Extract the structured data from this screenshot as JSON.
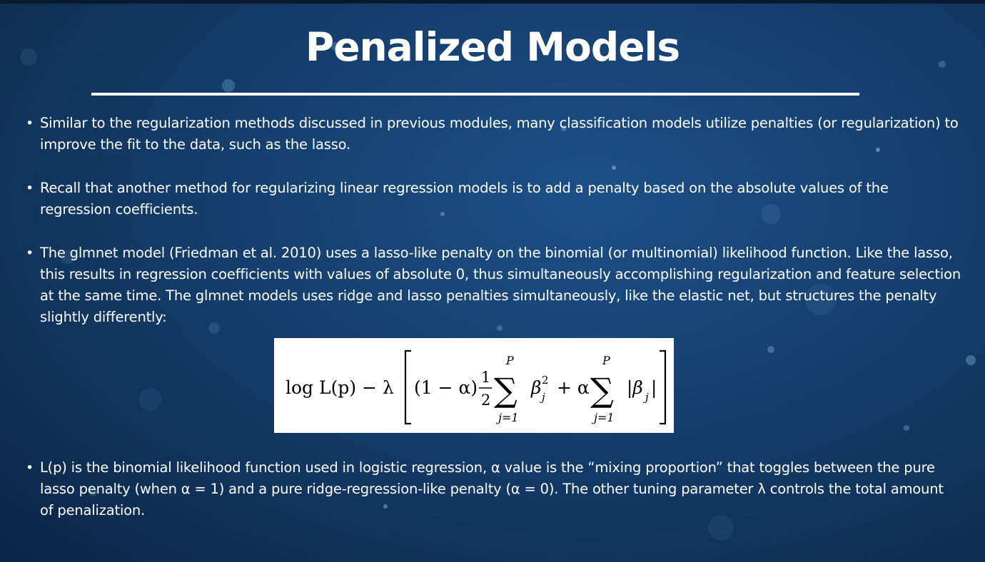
{
  "slide": {
    "title": "Penalized Models",
    "bullets": [
      "Similar to the regularization methods discussed in previous modules, many classification models utilize penalties (or regularization) to improve the fit to the data, such as the lasso.",
      "Recall that another method for regularizing linear regression models is to add a penalty based on the absolute values of the regression coefficients.",
      "The glmnet model (Friedman et al. 2010) uses a lasso-like penalty on the binomial (or multinomial) likelihood function. Like the lasso, this results in regression coefficients with values of absolute 0, thus simultaneously accomplishing regularization and feature selection at the same time. The glmnet models uses ridge and lasso penalties simultaneously, like the elastic net, but structures the penalty slightly differently:",
      "L(p) is the binomial likelihood function used in logistic regression, α value is the “mixing proportion” that toggles between the pure lasso penalty (when α = 1) and a pure ridge-regression-like penalty (α = 0). The other tuning parameter λ controls the total amount of penalization."
    ],
    "formula": {
      "log_L": "log L(p) − λ",
      "one_minus_alpha": "(1 − α)",
      "half_num": "1",
      "half_den": "2",
      "sum_upper": "P",
      "sum_lower": "j=1",
      "beta_sq": "β",
      "beta_sup": "2",
      "beta_sub": "j",
      "plus_alpha": "+ α",
      "abs_beta": "|β",
      "abs_sub": "j",
      "abs_close": "|"
    }
  },
  "colors": {
    "background": "#15406f",
    "text": "#ffffff",
    "formula_bg": "#ffffff",
    "formula_text": "#000000"
  }
}
